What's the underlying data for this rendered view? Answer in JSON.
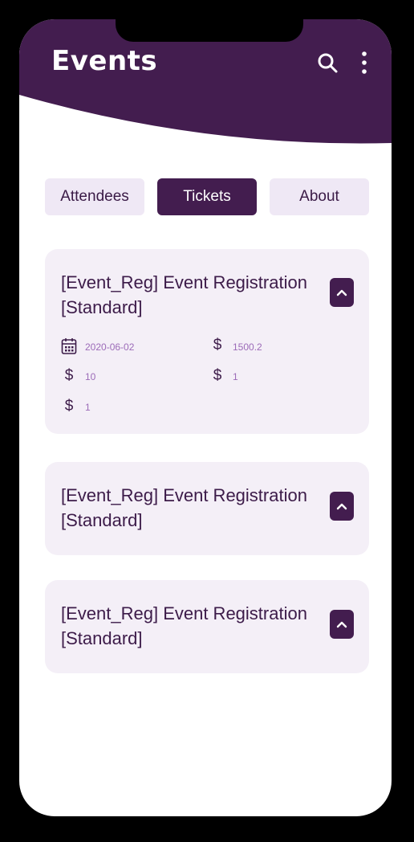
{
  "app": {
    "title": "Events"
  },
  "header": {
    "search_icon": "search-icon",
    "menu_icon": "more-vertical-icon"
  },
  "tabs": [
    {
      "label": "Attendees",
      "active": false
    },
    {
      "label": "Tickets",
      "active": true
    },
    {
      "label": "About",
      "active": false
    }
  ],
  "tickets": [
    {
      "title_line1": "[Event_Reg] Event Registration",
      "title_line2": "[Standard]",
      "expanded": true,
      "date": "2020-06-02",
      "price": "1500.2",
      "value_a": "10",
      "value_b": "1",
      "value_c": "1"
    },
    {
      "title_line1": "[Event_Reg] Event Registration",
      "title_line2": "[Standard]",
      "expanded": false
    },
    {
      "title_line1": "[Event_Reg] Event Registration",
      "title_line2": "[Standard]",
      "expanded": false
    }
  ],
  "colors": {
    "primary": "#431d4f",
    "card_bg": "#f4eff7",
    "tab_bg": "#efe8f5",
    "value_text": "#9c6bb8"
  },
  "icons": {
    "calendar": "calendar-icon",
    "dollar": "dollar-icon",
    "toggle": "chevron-up-icon"
  }
}
